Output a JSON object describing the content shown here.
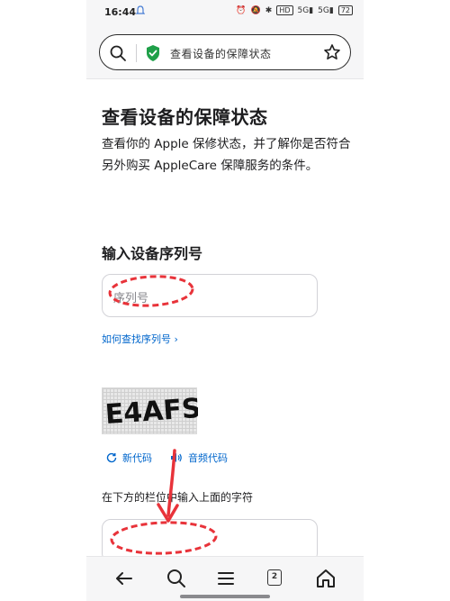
{
  "status_bar": {
    "time": "16:44",
    "network_badge": "HD",
    "signal1": "5G",
    "signal2": "5G",
    "battery": "72"
  },
  "address_bar": {
    "text": "查看设备的保障状态"
  },
  "page": {
    "title": "查看设备的保障状态",
    "description": "查看你的 Apple 保修状态，并了解你是否符合另外购买 AppleCare 保障服务的条件。",
    "serial_label": "输入设备序列号",
    "serial_placeholder": "序列号",
    "find_serial_link": "如何查找序列号 ›",
    "captcha_text": "E4AFS",
    "new_code": "新代码",
    "audio_code": "音频代码",
    "captcha_instruction": "在下方的栏位中输入上面的字符",
    "captcha_value": ""
  },
  "colors": {
    "link": "#0066cc",
    "annotation": "#e8333a",
    "shield": "#1fa049"
  },
  "nav": {
    "tabs_count": "2"
  }
}
